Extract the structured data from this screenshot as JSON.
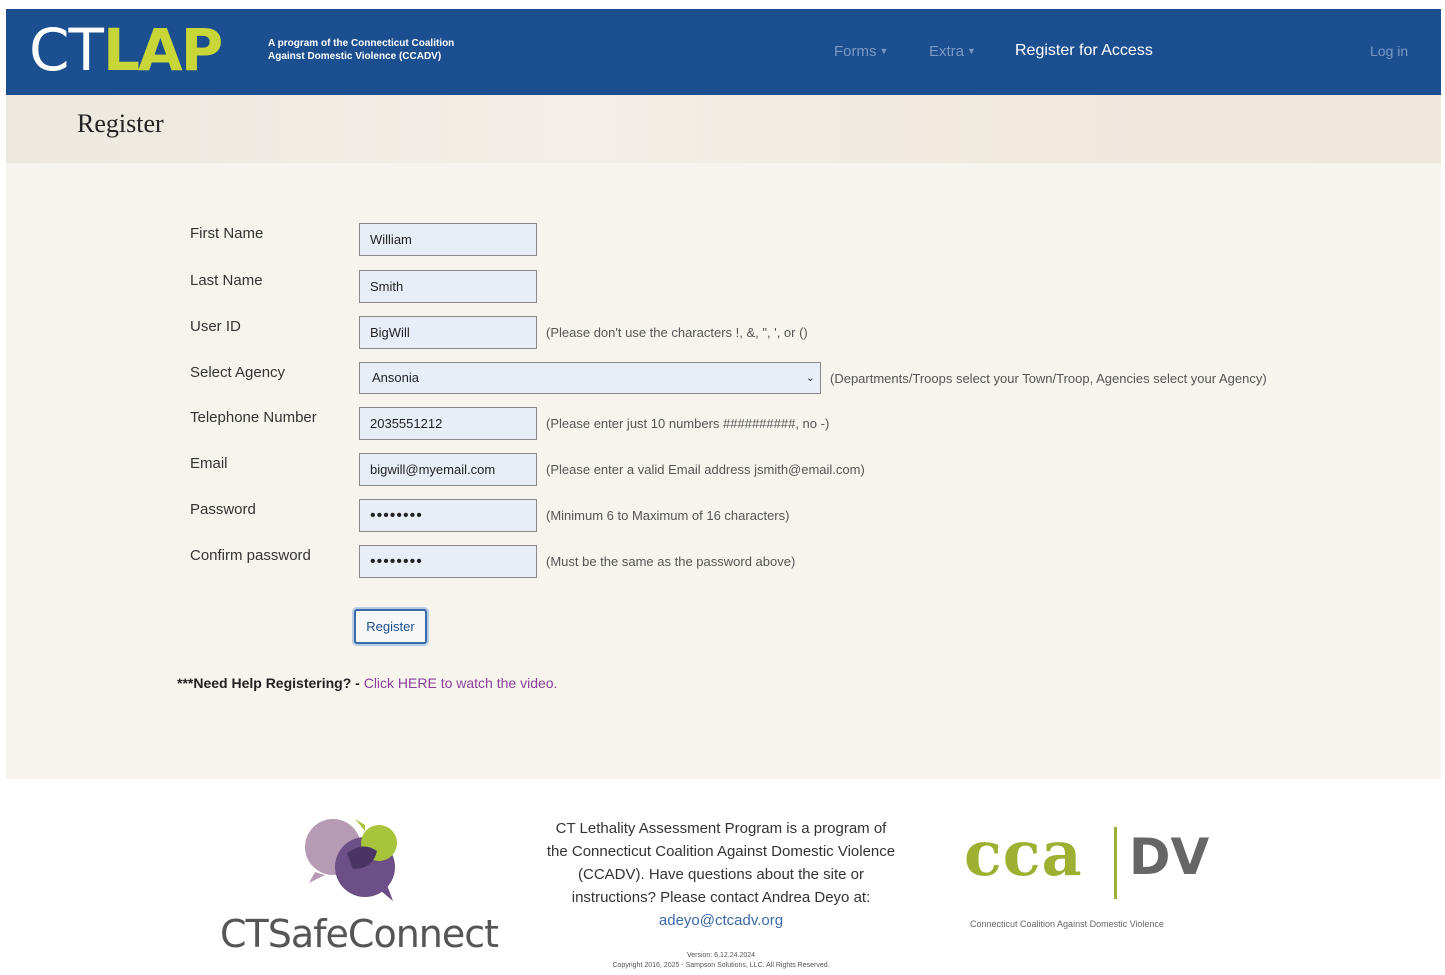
{
  "nav": {
    "logo_ct": "CT",
    "logo_lap": "LAP",
    "tagline_line1": "A program of the Connecticut Coalition",
    "tagline_line2": "Against Domestic Violence (CCADV)",
    "forms": "Forms",
    "extra": "Extra",
    "register_access": "Register for Access",
    "login": "Log in",
    "caret_icon": "caret-down-icon"
  },
  "page": {
    "title": "Register"
  },
  "form": {
    "first_name": {
      "label": "First Name",
      "value": "William"
    },
    "last_name": {
      "label": "Last Name",
      "value": "Smith"
    },
    "user_id": {
      "label": "User ID",
      "value": "BigWill",
      "hint": "(Please don't use the characters !, &, \", ', or ()"
    },
    "agency": {
      "label": "Select Agency",
      "value": "Ansonia",
      "hint": "(Departments/Troops select your Town/Troop, Agencies select your Agency)"
    },
    "telephone": {
      "label": "Telephone Number",
      "value": "2035551212",
      "hint": "(Please enter just 10 numbers ##########, no -)"
    },
    "email": {
      "label": "Email",
      "value": "bigwill@myemail.com",
      "hint": "(Please enter a valid Email address jsmith@email.com)"
    },
    "password": {
      "label": "Password",
      "value": "••••••••",
      "hint": "(Minimum 6 to Maximum of 16 characters)"
    },
    "confirm_password": {
      "label": "Confirm password",
      "value": "••••••••",
      "hint": "(Must be the same as the password above)"
    },
    "submit_label": "Register"
  },
  "help": {
    "prefix": "***Need Help Registering? - ",
    "link": "Click HERE to watch the video."
  },
  "footer": {
    "safeconnect": "CTSafeConnect",
    "info_text": "CT Lethality Assessment Program is a program of the Connecticut Coalition Against Domestic Violence (CCADV). Have questions about the site or instructions? Please contact Andrea Deyo at: ",
    "contact_email": "adeyo@ctcadv.org",
    "version": "Version: 6.12.24.2024",
    "copyright": "Copyright 2016, 2025 - Sampson Solutions, LLC. All Rights Reserved.",
    "cca_word": "cca",
    "cca_dv": "DV",
    "cca_sub": "Connecticut Coalition Against Domestic Violence"
  },
  "colors": {
    "nav_bg": "#1c4f8f",
    "logo_accent": "#c8d638",
    "link_purple": "#8a3e9a",
    "cca_green": "#9db031"
  }
}
